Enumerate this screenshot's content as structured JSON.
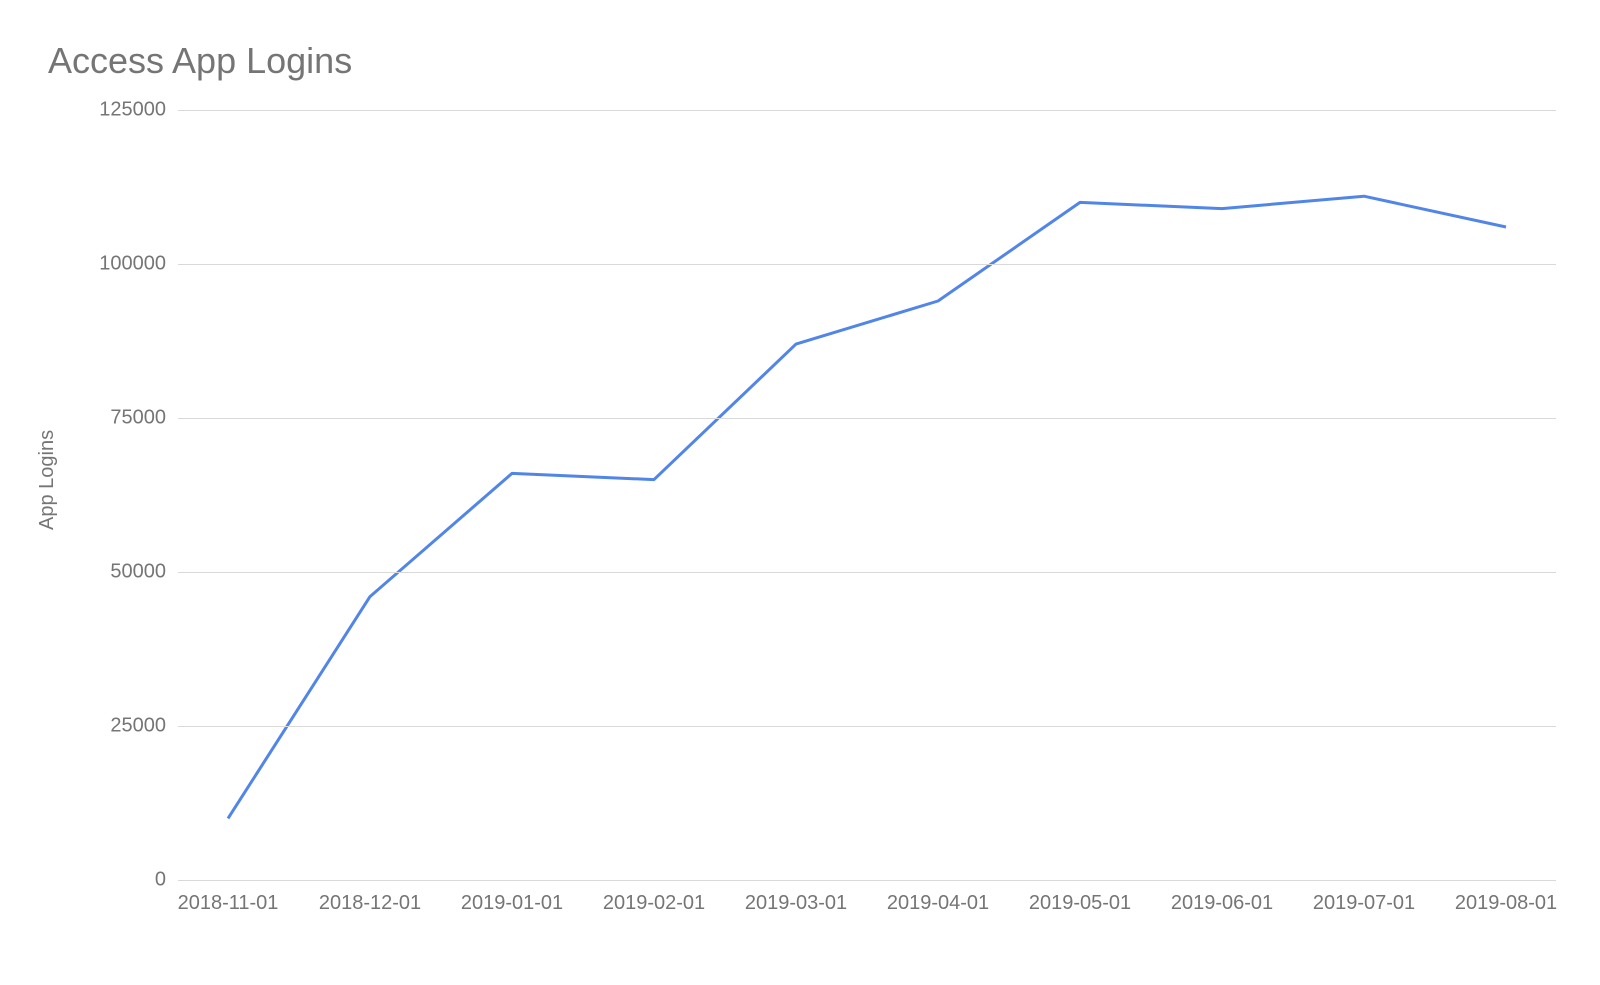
{
  "chart_data": {
    "type": "line",
    "title": "Access App Logins",
    "xlabel": "",
    "ylabel": "App Logins",
    "categories": [
      "2018-11-01",
      "2018-12-01",
      "2019-01-01",
      "2019-02-01",
      "2019-03-01",
      "2019-04-01",
      "2019-05-01",
      "2019-06-01",
      "2019-07-01",
      "2019-08-01"
    ],
    "values": [
      10000,
      46000,
      66000,
      65000,
      87000,
      94000,
      110000,
      109000,
      111000,
      106000
    ],
    "ylim": [
      0,
      125000
    ],
    "y_ticks": [
      0,
      25000,
      50000,
      75000,
      100000,
      125000
    ],
    "grid": true,
    "line_color": "#5185e8"
  }
}
